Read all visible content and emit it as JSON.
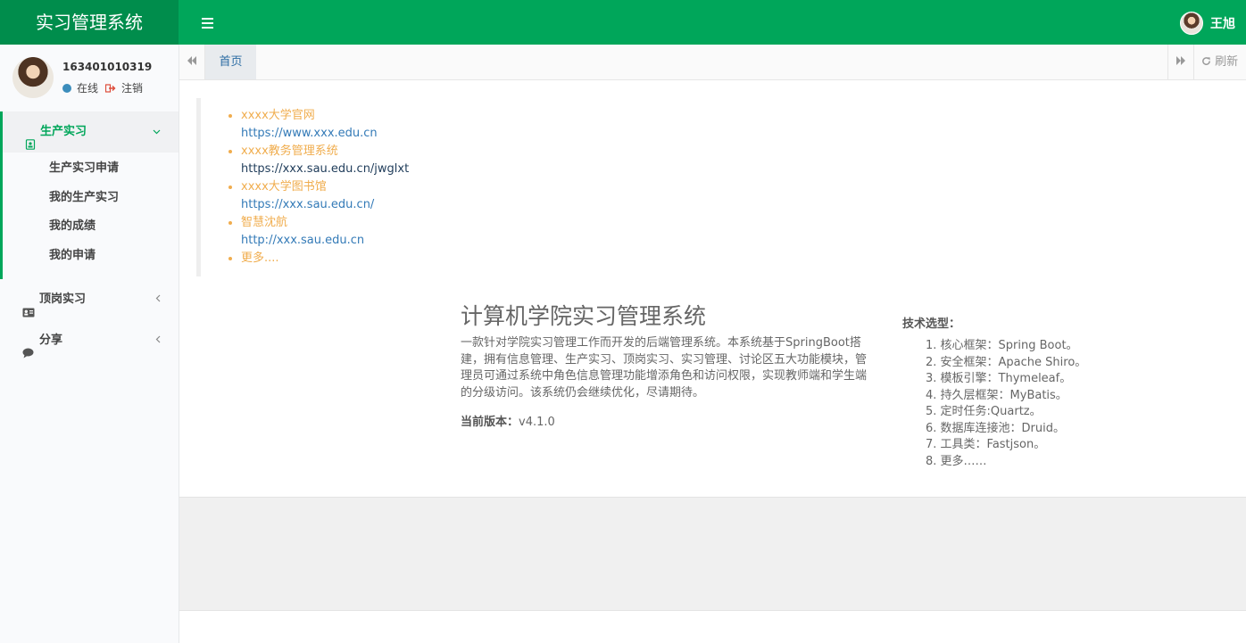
{
  "header": {
    "title": "实习管理系统",
    "user_name": "王旭"
  },
  "user_panel": {
    "id": "163401010319",
    "status": "在线",
    "logout": "注销"
  },
  "menu": [
    {
      "label": "生产实习",
      "expanded": true,
      "items": [
        "生产实习申请",
        "我的生产实习",
        "我的成绩",
        "我的申请"
      ]
    },
    {
      "label": "顶岗实习",
      "expanded": false
    },
    {
      "label": "分享",
      "expanded": false
    }
  ],
  "tabs": {
    "home": "首页",
    "refresh": "刷新"
  },
  "links": [
    {
      "name": "xxxx大学官网",
      "url": "https://www.xxx.edu.cn"
    },
    {
      "name": "xxxx教务管理系统",
      "url": "https://xxx.sau.edu.cn/jwglxt"
    },
    {
      "name": "xxxx大学图书馆",
      "url": "https://xxx.sau.edu.cn/"
    },
    {
      "name": "智慧沈航",
      "url": "http://xxx.sau.edu.cn"
    },
    {
      "name": "更多...."
    }
  ],
  "intro": {
    "title": "计算机学院实习管理系统",
    "description": "一款针对学院实习管理工作而开发的后端管理系统。本系统基于SpringBoot搭建，拥有信息管理、生产实习、顶岗实习、实习管理、讨论区五大功能模块，管理员可通过系统中角色信息管理功能增添角色和访问权限，实现教师端和学生端的分级访问。该系统仍会继续优化，尽请期待。",
    "version_label": "当前版本：",
    "version": "v4.1.0"
  },
  "tech": {
    "heading": "技术选型：",
    "items": [
      "1. 核心框架：Spring Boot。",
      "2. 安全框架：Apache Shiro。",
      "3. 模板引擎：Thymeleaf。",
      "4. 持久层框架：MyBatis。",
      "5. 定时任务:Quartz。",
      "6. 数据库连接池：Druid。",
      "7. 工具类：Fastjson。",
      "8. 更多……"
    ]
  },
  "colors": {
    "header": "#00a65a",
    "logo_bg": "#008d4c",
    "link_name": "#f0ad4e",
    "link_url": "#337ab7"
  }
}
